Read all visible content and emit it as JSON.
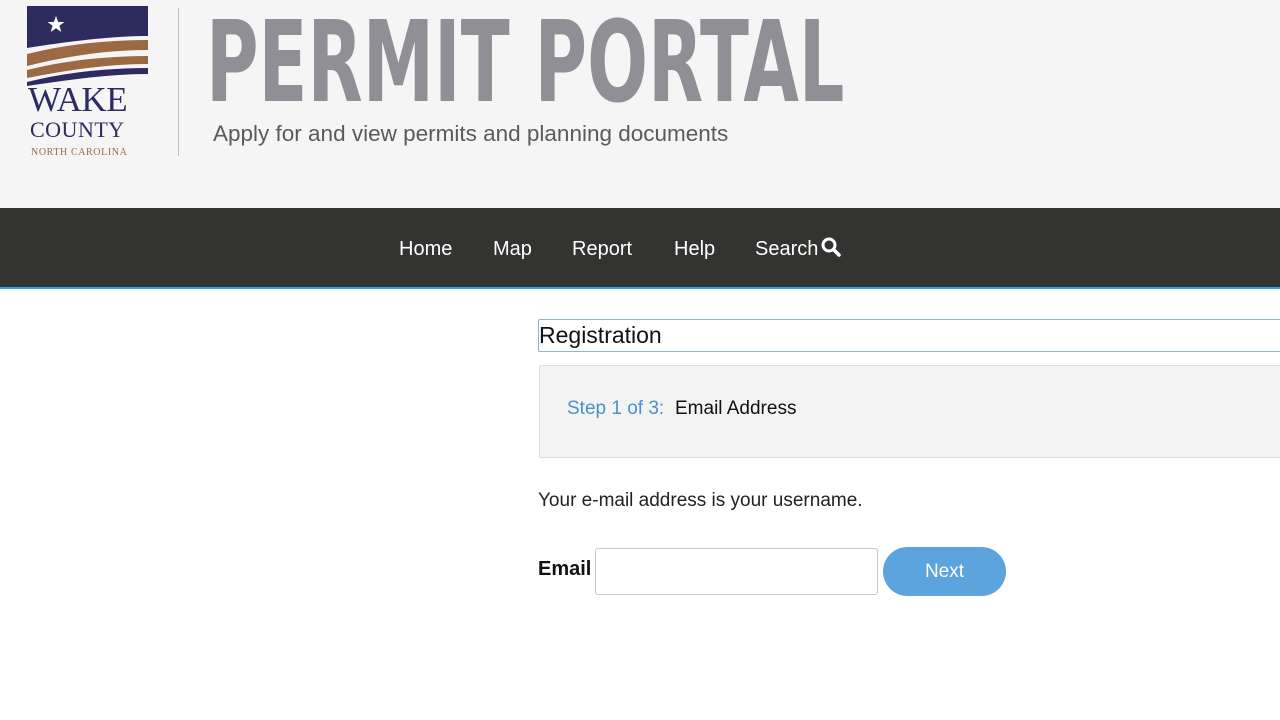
{
  "header": {
    "logo": {
      "line1": "WAKE",
      "line2": "COUNTY",
      "line3": "NORTH CAROLINA",
      "colors": {
        "navy": "#2e2b5f",
        "brown": "#9b6a45"
      }
    },
    "title": "PERMIT PORTAL",
    "subtitle": "Apply for and view permits and planning documents"
  },
  "nav": {
    "items": [
      {
        "label": "Home"
      },
      {
        "label": "Map"
      },
      {
        "label": "Report"
      },
      {
        "label": "Help"
      },
      {
        "label": "Search",
        "icon": "search-icon"
      }
    ],
    "background": "#333431",
    "accent": "#3aa0e0"
  },
  "registration": {
    "title": "Registration",
    "step": {
      "label": "Step 1 of 3:",
      "name": "Email Address"
    },
    "helper_text": "Your e-mail address is your username.",
    "email": {
      "label": "Email",
      "value": "",
      "placeholder": ""
    },
    "next_label": "Next",
    "accent": "#5ba4dd"
  }
}
